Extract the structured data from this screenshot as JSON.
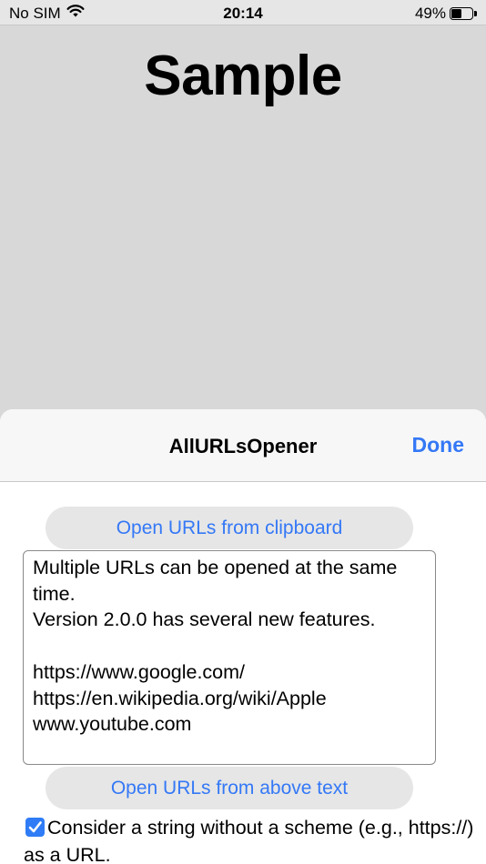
{
  "status_bar": {
    "carrier": "No SIM",
    "time": "20:14",
    "battery_percent": "49%",
    "battery_level": 0.49,
    "wifi_icon": "wifi-icon",
    "battery_icon": "battery-icon"
  },
  "background": {
    "title": "Sample"
  },
  "sheet": {
    "title": "AllURLsOpener",
    "done_label": "Done",
    "open_clipboard_label": "Open URLs from clipboard",
    "text_content": "Multiple URLs can be opened at the same time.\nVersion 2.0.0 has several new features.\n\nhttps://www.google.com/\nhttps://en.wikipedia.org/wiki/Apple\nwww.youtube.com",
    "open_above_label": "Open URLs from above text",
    "scheme_option": {
      "checked": true,
      "label": "Consider a string without a scheme (e.g., https://) as a URL."
    }
  },
  "colors": {
    "accent": "#3478f6",
    "checkbox": "#2f7cf6",
    "background_dim": "#d8d8d8",
    "button_fill": "#e6e6e6"
  }
}
